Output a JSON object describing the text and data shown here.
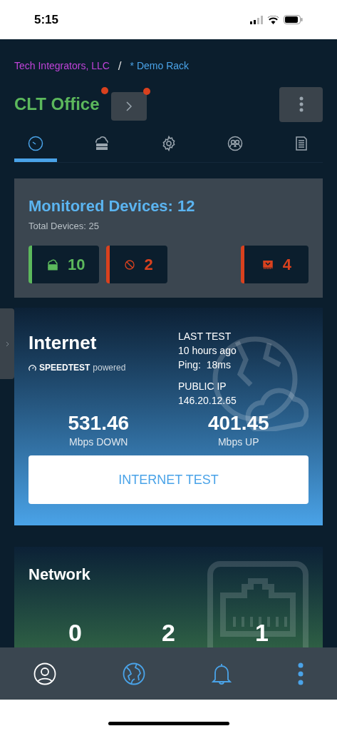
{
  "status_bar": {
    "time": "5:15"
  },
  "breadcrumb": {
    "organization": "Tech Integrators, LLC",
    "separator": "/",
    "site": "* Demo Rack"
  },
  "header": {
    "title": "CLT Office",
    "title_alert": true,
    "next_alert": true
  },
  "tabs": [
    {
      "kind": "dashboard",
      "selected": true
    },
    {
      "kind": "devices",
      "selected": false
    },
    {
      "kind": "settings",
      "selected": false
    },
    {
      "kind": "users",
      "selected": false
    },
    {
      "kind": "reports",
      "selected": false
    }
  ],
  "monitored": {
    "title": "Monitored Devices: 12",
    "subtitle": "Total Devices: 25",
    "chips": [
      {
        "kind": "online",
        "count": "10",
        "color": "#5cb85c"
      },
      {
        "kind": "blocked",
        "count": "2",
        "color": "#d9411e"
      },
      {
        "kind": "alert",
        "count": "4",
        "color": "#d9411e"
      }
    ]
  },
  "internet": {
    "title": "Internet",
    "speedtest_brand": "SPEEDTEST",
    "speedtest_suffix": "powered",
    "last_test_label": "LAST TEST",
    "last_test": "10 hours ago",
    "ping": "Ping:  18ms",
    "public_ip_label": "PUBLIC IP",
    "public_ip": "146.20.12.65",
    "down": "531.46",
    "down_label": "Mbps DOWN",
    "up": "401.45",
    "up_label": "Mbps UP",
    "button": "INTERNET TEST"
  },
  "network": {
    "title": "Network",
    "counts": [
      "0",
      "2",
      "1"
    ]
  },
  "bottom_nav": [
    {
      "kind": "profile"
    },
    {
      "kind": "globe"
    },
    {
      "kind": "bell"
    },
    {
      "kind": "more"
    }
  ]
}
